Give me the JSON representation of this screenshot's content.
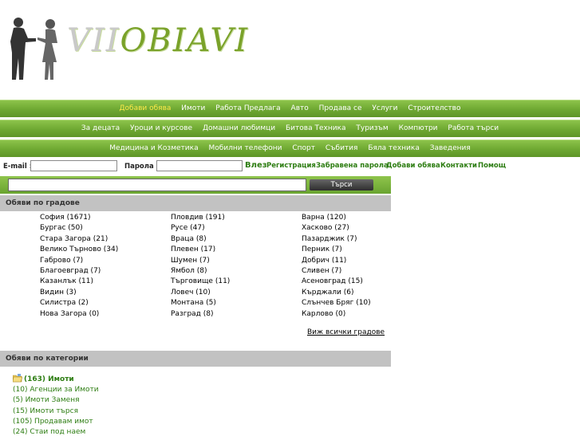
{
  "logo": {
    "prefix": "VII",
    "suffix": "OBIAVI"
  },
  "nav": {
    "row1": [
      "Добави обява",
      "Имоти",
      "Работа Предлага",
      "Авто",
      "Продава се",
      "Услуги",
      "Строителство"
    ],
    "row2": [
      "За децата",
      "Уроци и курсове",
      "Домашни любимци",
      "Битова Техника",
      "Туризъм",
      "Компютри",
      "Работа търси"
    ],
    "row3": [
      "Медицина и Козметика",
      "Мобилни телефони",
      "Спорт",
      "Събития",
      "Бяла техника",
      "Заведения"
    ],
    "active": "Добави обява"
  },
  "login": {
    "email_label": "E-mail :",
    "email_value": "",
    "password_label": "Парола :",
    "password_value": "",
    "links": [
      "Влез",
      "Регистрация",
      "Забравена парола",
      "Добави обява",
      "Контакти",
      "Помощ"
    ]
  },
  "search": {
    "value": "",
    "button": "Търси"
  },
  "cities_section": {
    "title": "Обяви по градове",
    "columns": [
      [
        "София (1671)",
        "Бургас (50)",
        "Стара Загора (21)",
        "Велико Търново (34)",
        "Габрово (7)",
        "Благоевград (7)",
        "Казанлък (11)",
        "Видин (3)",
        "Силистра (2)",
        "Нова Загора (0)"
      ],
      [
        "Пловдив (191)",
        "Русе (47)",
        "Враца (8)",
        "Плевен (17)",
        "Шумен (7)",
        "Ямбол (8)",
        "Търговище (11)",
        "Ловеч (10)",
        "Монтана (5)",
        "Разград (8)"
      ],
      [
        "Варна (120)",
        "Хасково (27)",
        "Пазарджик (7)",
        "Перник (7)",
        "Добрич (11)",
        "Сливен (7)",
        "Асеновград (15)",
        "Кърджали (6)",
        "Слънчев Бряг (10)",
        "Карлово (0)"
      ]
    ],
    "all_link": "Виж всички градове"
  },
  "categories_section": {
    "title": "Обяви по категории",
    "main": {
      "label": "(163) Имоти",
      "icon": "folder-icon"
    },
    "subcategories": [
      "(10) Агенции за Имоти",
      "(5) Имоти Заменя",
      "(15) Имоти търся",
      "(105) Продавам имот",
      "(24) Стаи под наем"
    ]
  }
}
